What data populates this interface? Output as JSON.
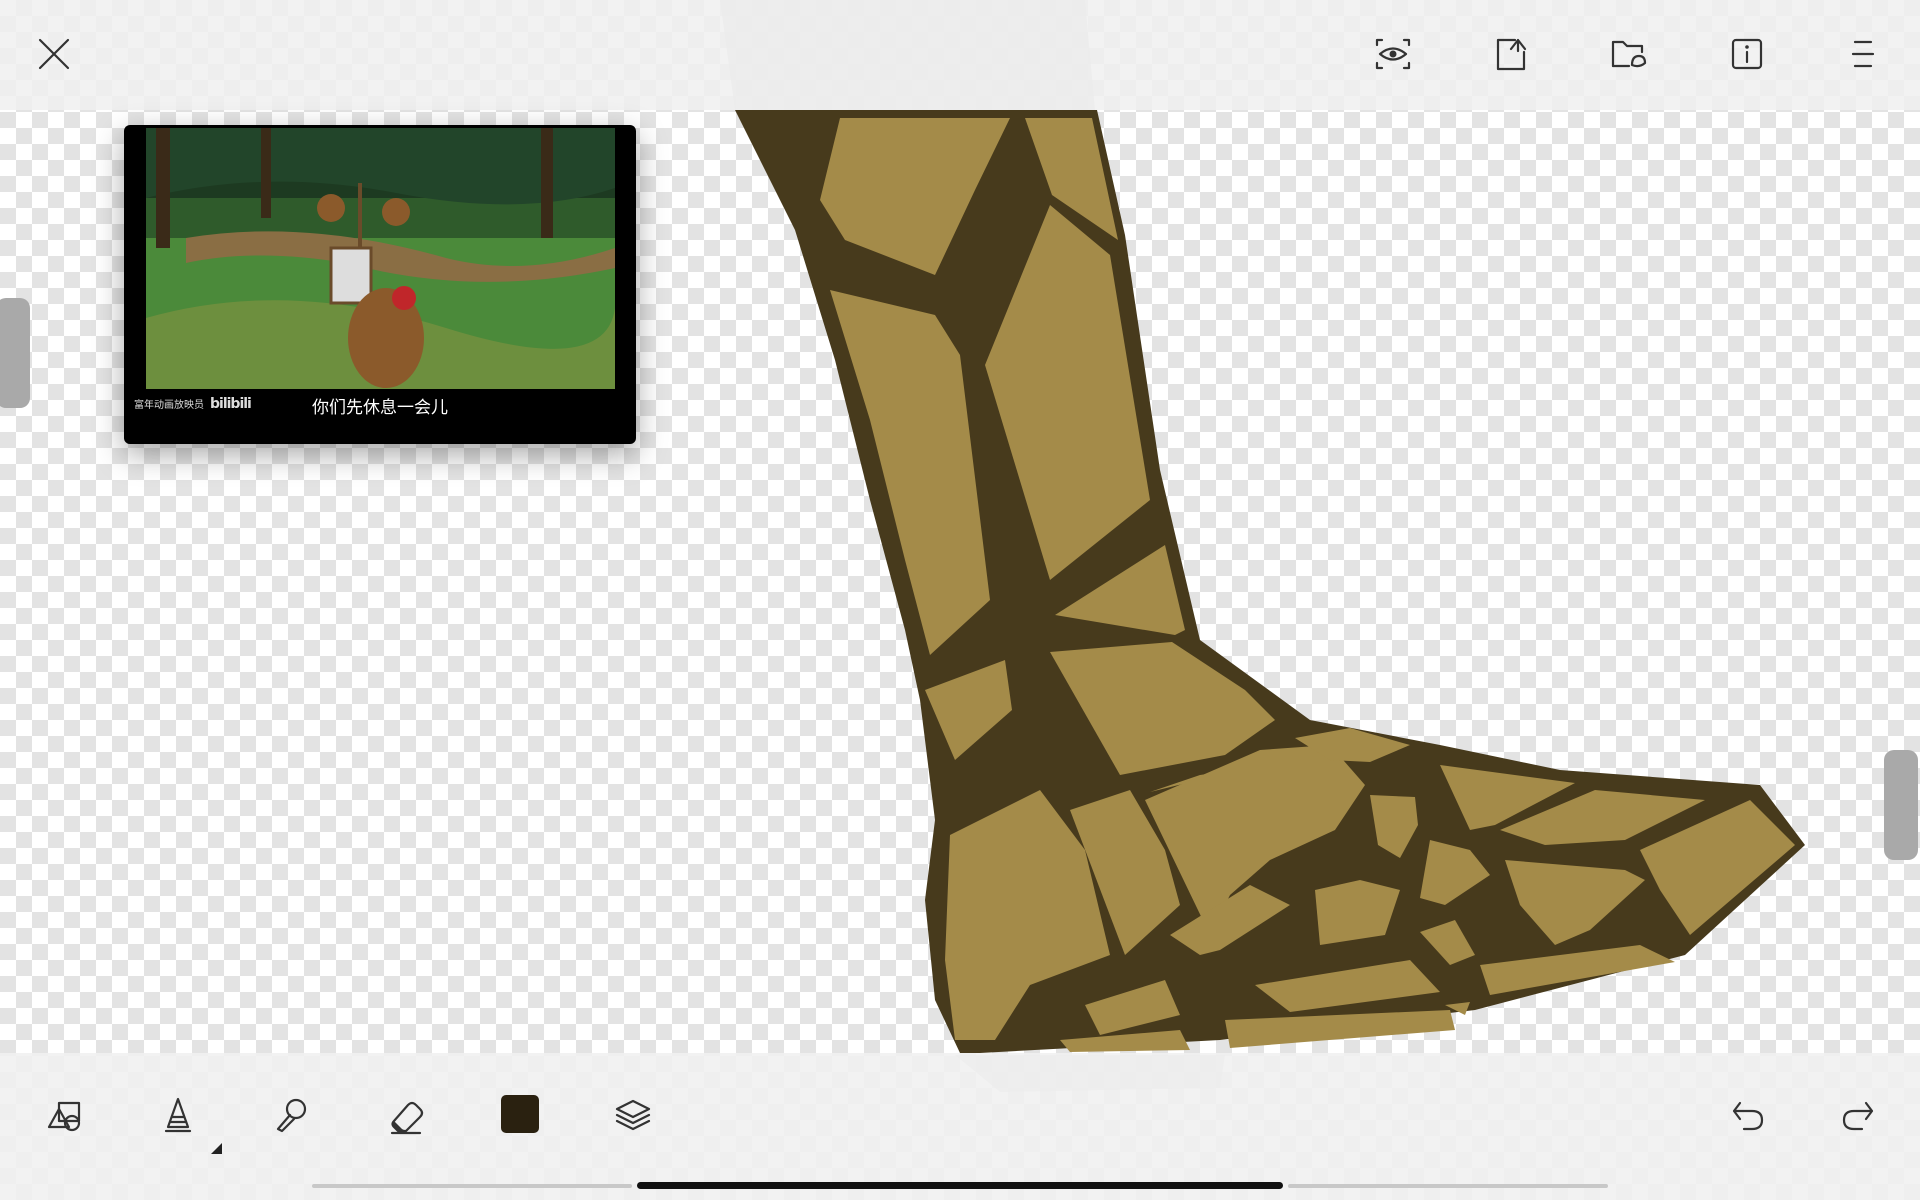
{
  "video": {
    "subtitle": "你们先休息一会儿",
    "watermark_text": "富年动画放映员",
    "watermark_logo": "bilibili"
  },
  "top_toolbar": {
    "close": "close-icon",
    "reference": "eye-scan-icon",
    "import": "import-image-icon",
    "gallery": "folder-icon",
    "info": "info-icon",
    "menu": "menu-icon"
  },
  "bottom_toolbar": {
    "shapes": "shapes-icon",
    "brush": "brush-icon",
    "smudge": "smudge-icon",
    "eraser": "eraser-icon",
    "layers": "layers-icon",
    "undo": "undo-icon",
    "redo": "redo-icon"
  },
  "colors": {
    "current_color": "#2a2110",
    "armor_fill": "#a48b49",
    "armor_outline": "#473a1c",
    "toolbar_bg": "#f0f0f0",
    "icon_color": "#333333"
  }
}
